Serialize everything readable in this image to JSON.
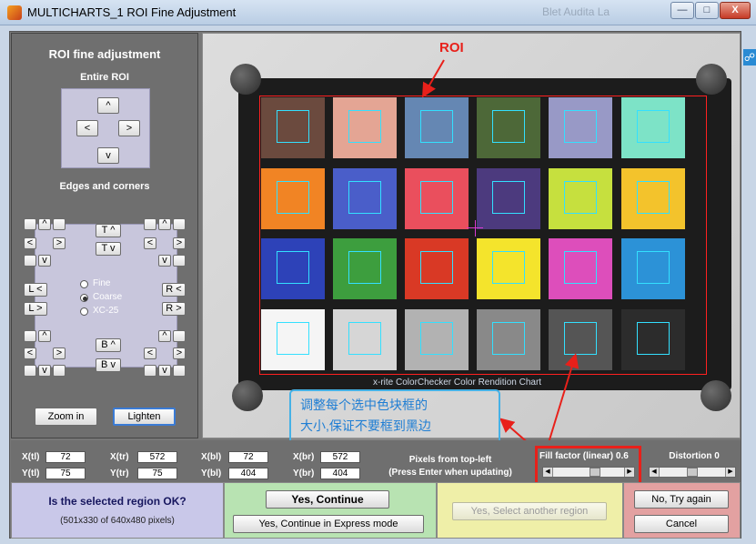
{
  "window": {
    "title": "MULTICHARTS_1 ROI Fine Adjustment",
    "ghost_text": "Blet Audita La",
    "controls": {
      "minimize": "—",
      "maximize": "□",
      "close": "X"
    }
  },
  "left_panel": {
    "heading": "ROI fine adjustment",
    "entire_roi_label": "Entire ROI",
    "edges_label": "Edges and corners",
    "arrows": {
      "up": "^",
      "down": "v",
      "left": "<",
      "right": ">"
    },
    "top_up": "T ^",
    "top_down": "T v",
    "bottom_up": "B ^",
    "bottom_down": "B v",
    "left_left": "L <",
    "left_right": "L >",
    "right_left": "R <",
    "right_right": "R >",
    "radio_options": [
      "Fine",
      "Coarse",
      "XC-25"
    ],
    "radio_selected": "Coarse",
    "zoom_in": "Zoom in",
    "lighten": "Lighten"
  },
  "image": {
    "roi_label": "ROI",
    "chart_caption": "x-rite ColorChecker Color Rendition Chart",
    "callout_line1": "调整每个选中色块框的",
    "callout_line2": "大小,保证不要框到黑边",
    "patch_colors": [
      [
        "#6b4a3e",
        "#e4a594",
        "#6587b3",
        "#4d6838",
        "#9899c6",
        "#7de3c7"
      ],
      [
        "#f18424",
        "#4a5ec9",
        "#ea4f5d",
        "#4c3a7e",
        "#c6e03e",
        "#f3c32c"
      ],
      [
        "#2d42b8",
        "#3d9e3e",
        "#d93925",
        "#f4e42c",
        "#dd4ebb",
        "#2c92d7"
      ],
      [
        "#f5f5f5",
        "#d6d6d6",
        "#b2b2b2",
        "#898989",
        "#555555",
        "#2c2c2c"
      ]
    ]
  },
  "coords": {
    "x_tl_label": "X(tl)",
    "x_tl": "72",
    "y_tl_label": "Y(tl)",
    "y_tl": "75",
    "x_tr_label": "X(tr)",
    "x_tr": "572",
    "y_tr_label": "Y(tr)",
    "y_tr": "75",
    "x_bl_label": "X(bl)",
    "x_bl": "72",
    "y_bl_label": "Y(bl)",
    "y_bl": "404",
    "x_br_label": "X(br)",
    "x_br": "572",
    "y_br_label": "Y(br)",
    "y_br": "404",
    "pixels_note": "Pixels from top-left",
    "enter_note": "(Press Enter when updating)",
    "fill_factor_label": "Fill factor (linear) 0.6",
    "fill_factor_value": 0.6,
    "distortion_label": "Distortion 0",
    "distortion_value": 0
  },
  "actions": {
    "question": "Is the selected region OK?",
    "size_info": "(501x330 of 640x480 pixels)",
    "yes_continue": "Yes, Continue",
    "yes_express": "Yes, Continue in Express mode",
    "yes_another": "Yes, Select another region",
    "no_retry": "No, Try again",
    "cancel": "Cancel"
  },
  "colors": {
    "roi_outline": "#ff2020",
    "patch_frame": "#33e0ff",
    "callout_border": "#45b1e6",
    "annotation_red": "#e8201a"
  }
}
